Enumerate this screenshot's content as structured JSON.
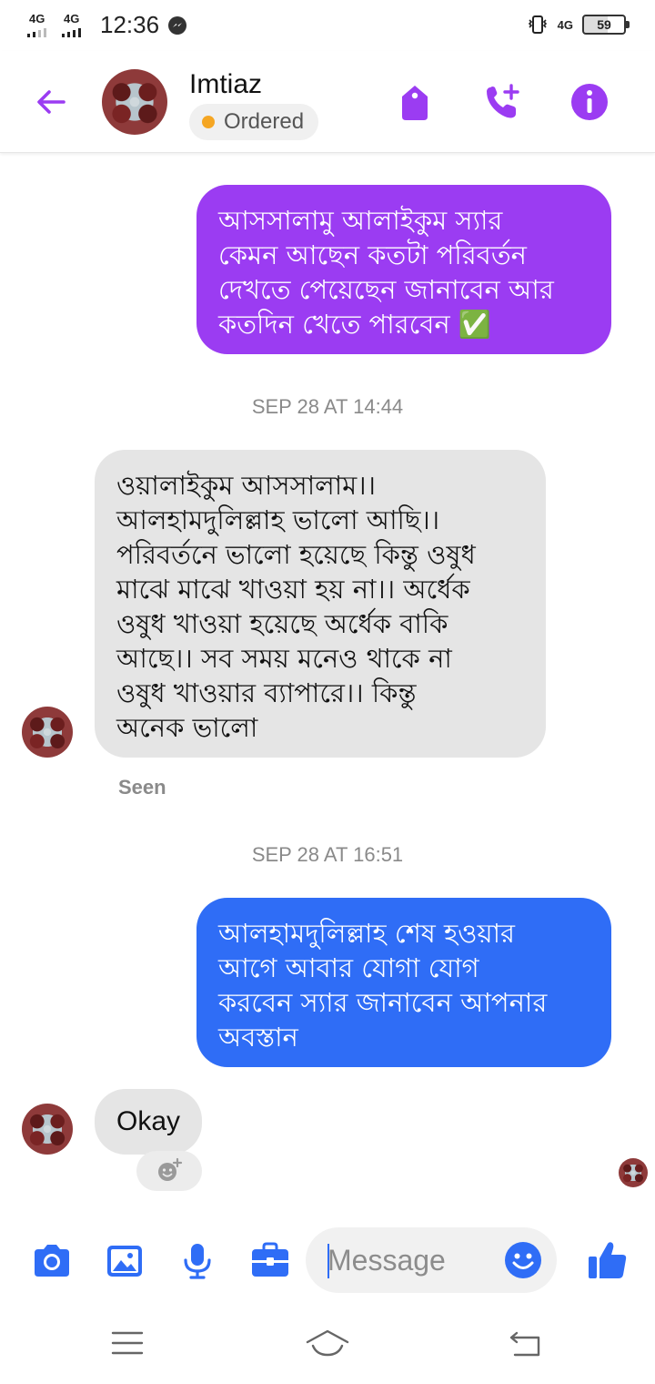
{
  "status_bar": {
    "sim1": "4G",
    "sim2": "4G",
    "time": "12:36",
    "network_right": "4G",
    "battery": "59"
  },
  "header": {
    "contact_name": "Imtiaz",
    "status_label": "Ordered",
    "status_color": "#f5a623",
    "icons": [
      "back-arrow-icon",
      "tag-icon",
      "add-call-icon",
      "info-icon"
    ],
    "accent": "#9b3cf2"
  },
  "messages": [
    {
      "direction": "outgoing",
      "color": "#9b3cf2",
      "lines": [
        "আসসালামু আলাইকুম স্যার",
        "কেমন আছেন কতটা পরিবর্তন",
        "দেখতে পেয়েছেন জানাবেন আর",
        "কতদিন খেতে পারবেন ✅"
      ]
    },
    {
      "timestamp": "SEP 28 AT 14:44"
    },
    {
      "direction": "incoming",
      "lines": [
        "ওয়ালাইকুম আসসালাম।।",
        "আলহামদুলিল্লাহ ভালো আছি।।",
        "পরিবর্তনে ভালো হয়েছে কিন্তু ওষুধ",
        "মাঝে মাঝে খাওয়া হয় না।। অর্ধেক",
        "ওষুধ খাওয়া হয়েছে অর্ধেক বাকি",
        "আছে।। সব সময় মনেও থাকে না",
        "ওষুধ খাওয়ার ব্যাপারে।। কিন্তু",
        "অনেক ভালো"
      ]
    },
    {
      "receipt": "Seen"
    },
    {
      "timestamp": "SEP 28 AT 16:51"
    },
    {
      "direction": "outgoing",
      "color": "#2f6df6",
      "lines": [
        "আলহামদুলিল্লাহ শেষ হওয়ার",
        "আগে আবার যোগা যোগ",
        "করবেন স্যার জানাবেন আপনার",
        "অবস্তান"
      ]
    },
    {
      "direction": "incoming",
      "text": "Okay"
    }
  ],
  "composer": {
    "placeholder": "Message",
    "icons": [
      "camera-icon",
      "image-icon",
      "microphone-icon",
      "briefcase-icon",
      "emoji-icon",
      "thumbs-up-icon"
    ],
    "icon_color": "#2f6df6"
  },
  "nav": {
    "icons": [
      "menu-icon",
      "home-icon",
      "back-icon"
    ]
  }
}
